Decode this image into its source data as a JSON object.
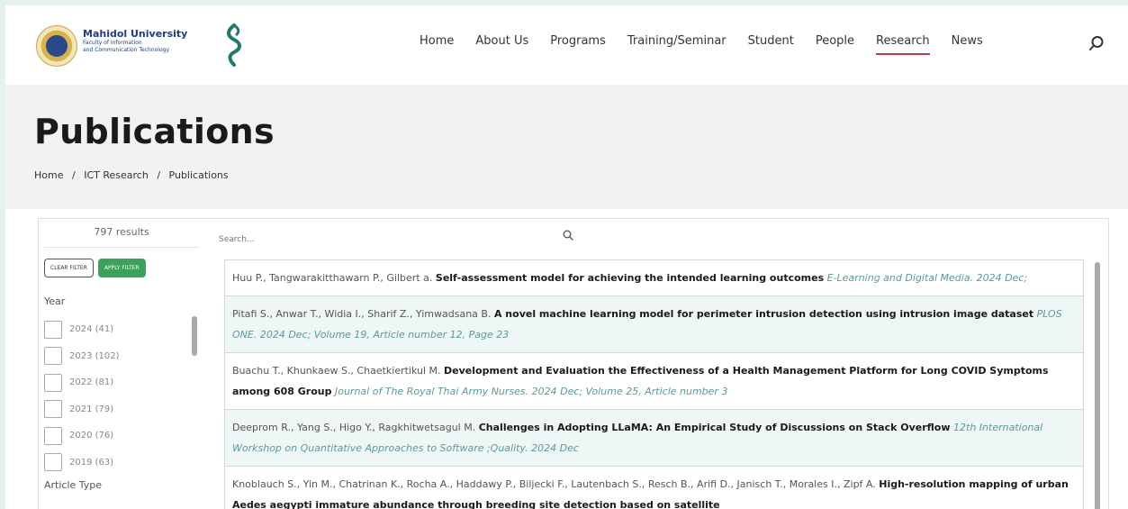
{
  "header": {
    "logo_title": "Mahidol University",
    "logo_sub1": "Faculty of Information",
    "logo_sub2": "and Communication Technology",
    "nav": [
      "Home",
      "About Us",
      "Programs",
      "Training/Seminar",
      "Student",
      "People",
      "Research",
      "News"
    ],
    "active_nav": "Research",
    "icons": {
      "search": "search-icon",
      "brand": "mahidol-seal"
    }
  },
  "page": {
    "title": "Publications",
    "breadcrumb": [
      "Home",
      "/",
      "ICT Research",
      "/",
      "Publications"
    ]
  },
  "sidebar": {
    "results": "797 results",
    "clear_filter": "CLEAR FILTER",
    "apply_filter": "APPLY FILTER",
    "year_label": "Year",
    "years": [
      "2024 (41)",
      "2023 (102)",
      "2022 (81)",
      "2021 (79)",
      "2020 (76)",
      "2019 (63)"
    ],
    "article_type_label": "Article Type"
  },
  "search": {
    "placeholder": "Search..."
  },
  "publications": [
    {
      "authors": "Huu P., Tangwarakitthawarn P., Gilbert a.",
      "title": "Self-assessment model for achieving the intended learning outcomes",
      "journal": "E-Learning and Digital Media. 2024 Dec;"
    },
    {
      "authors": "Pitafi S., Anwar T., Widia I., Sharif Z., Yimwadsana B.",
      "title": "A novel machine learning model for perimeter intrusion detection using intrusion image dataset",
      "journal": "PLOS ONE. 2024 Dec; Volume 19, Article number 12, Page 23"
    },
    {
      "authors": "Buachu T., Khunkaew S., Chaetkiertikul M.",
      "title": "Development and Evaluation the Effectiveness of a Health Management Platform for Long COVID Symptoms among 608 Group",
      "journal": "Journal of The Royal Thai Army Nurses. 2024 Dec; Volume 25, Article number 3"
    },
    {
      "authors": "Deeprom R., Yang S., Higo Y., Ragkhitwetsagul M.",
      "title": "Challenges in Adopting LLaMA: An Empirical Study of Discussions on Stack Overflow",
      "journal": "12th International Workshop on Quantitative Approaches to Software ;Quality. 2024 Dec"
    },
    {
      "authors": "Knoblauch S., Yin M., Chatrinan K., Rocha A., Haddawy P., Biljecki F., Lautenbach S., Resch B., Arifi D., Janisch T., Morales I., Zipf A.",
      "title": "High-resolution mapping of urban Aedes aegypti immature abundance through breeding site detection based on satellite",
      "journal": ""
    }
  ],
  "colors": {
    "accent": "#c0394b",
    "apply_green": "#3aa357",
    "alt_row": "#eef6f6",
    "journal": "#5a9a9a"
  }
}
